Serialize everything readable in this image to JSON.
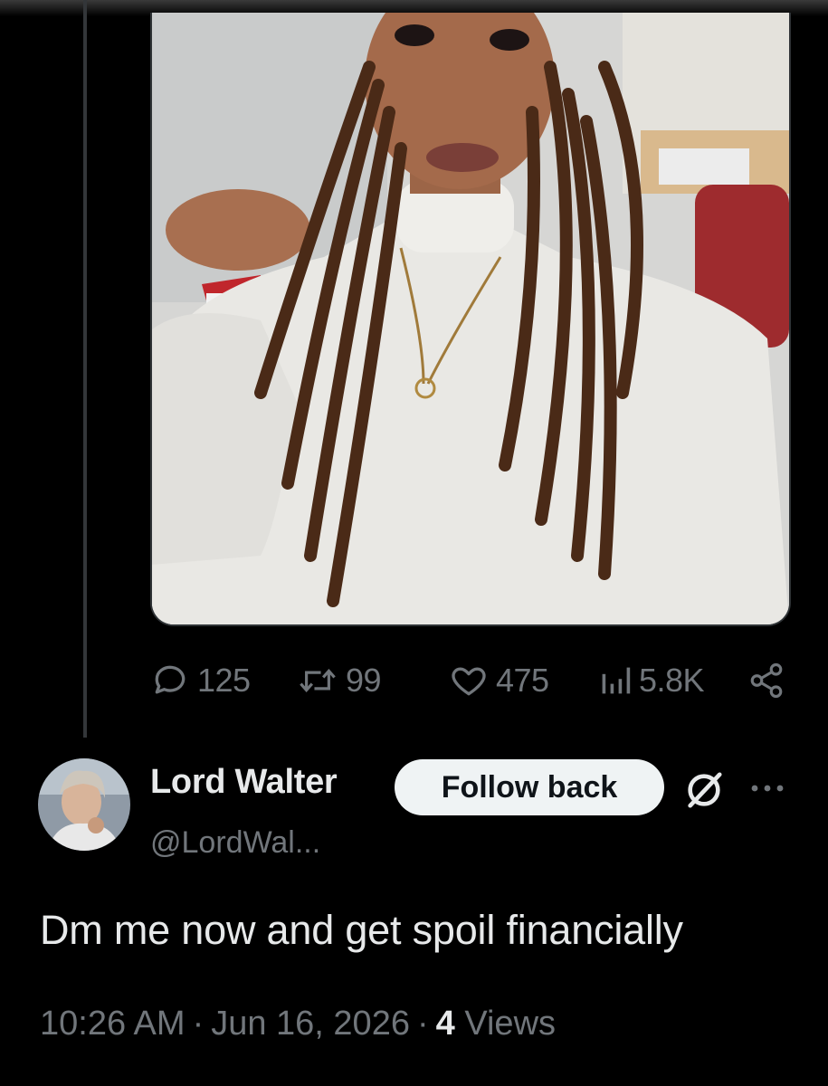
{
  "tweet_media": {
    "alt": "photo"
  },
  "actions": {
    "replies": "125",
    "retweets": "99",
    "likes": "475",
    "views": "5.8K"
  },
  "reply": {
    "author_name": "Lord Walter",
    "author_handle": "@LordWal...",
    "follow_label": "Follow back",
    "text": "Dm me now and get spoil financially",
    "time": "10:26 AM",
    "date": "Jun 16, 2026",
    "separator": "·",
    "views_count": "4",
    "views_label": "Views"
  },
  "colors": {
    "background": "#000000",
    "primary_text": "#e7e9ea",
    "secondary_text": "#71767b",
    "follow_button_bg": "#eff3f4"
  },
  "icons": {
    "reply": "speech-bubble-icon",
    "retweet": "retweet-icon",
    "like": "heart-icon",
    "views": "bar-chart-icon",
    "share": "share-icon",
    "grok": "grok-icon",
    "more": "more-dots-icon"
  }
}
